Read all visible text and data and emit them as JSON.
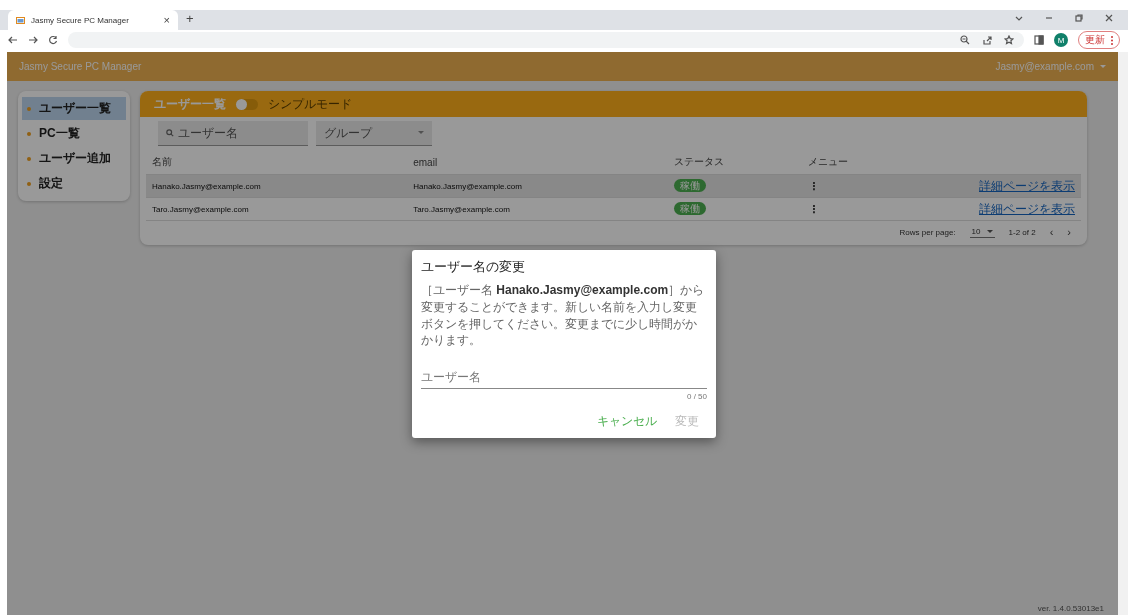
{
  "browser": {
    "tab_title": "Jasmy Secure PC Manager",
    "tab_close": "×",
    "new_tab": "+",
    "update_button": "更新",
    "profile_initial": "M"
  },
  "app_bar": {
    "title": "Jasmy Secure PC Manager",
    "account": "Jasmy@example.com"
  },
  "sidebar": {
    "items": [
      {
        "label": "ユーザー一覧",
        "selected": true
      },
      {
        "label": "PC一覧",
        "selected": false
      },
      {
        "label": "ユーザー追加",
        "selected": false
      },
      {
        "label": "設定",
        "selected": false
      }
    ]
  },
  "panel": {
    "title": "ユーザー一覧",
    "simple_mode": {
      "label": "シンプルモード",
      "on": false
    },
    "search": {
      "placeholder": "ユーザー名"
    },
    "group_select": {
      "placeholder": "グループ"
    },
    "table": {
      "columns": [
        "名前",
        "email",
        "ステータス",
        "メニュー"
      ],
      "rows": [
        {
          "name": "Hanako.Jasmy@example.com",
          "email": "Hanako.Jasmy@example.com",
          "status": "稼働",
          "menu": "⋮",
          "link": "詳細ページを表示",
          "selected": true
        },
        {
          "name": "Taro.Jasmy@example.com",
          "email": "Taro.Jasmy@example.com",
          "status": "稼働",
          "menu": "⋮",
          "link": "詳細ページを表示",
          "selected": false
        }
      ]
    },
    "pagination": {
      "rows_per_page_label": "Rows per page:",
      "rows_per_page": "10",
      "range": "1-2 of 2",
      "prev": "‹",
      "next": "›"
    }
  },
  "dialog": {
    "title": "ユーザー名の変更",
    "message": "［ユーザー名 **Hanako.Jasmy@example.com**］から変更することができます。新しい名前を入力し変更ボタンを押してください。変更までに少し時間がかかります。",
    "field": {
      "label": "ユーザー名",
      "counter": "0 / 50"
    },
    "cancel": "キャンセル",
    "confirm": {
      "label": "変更",
      "disabled": true
    }
  },
  "version": "ver. 1.4.0.53013e1"
}
